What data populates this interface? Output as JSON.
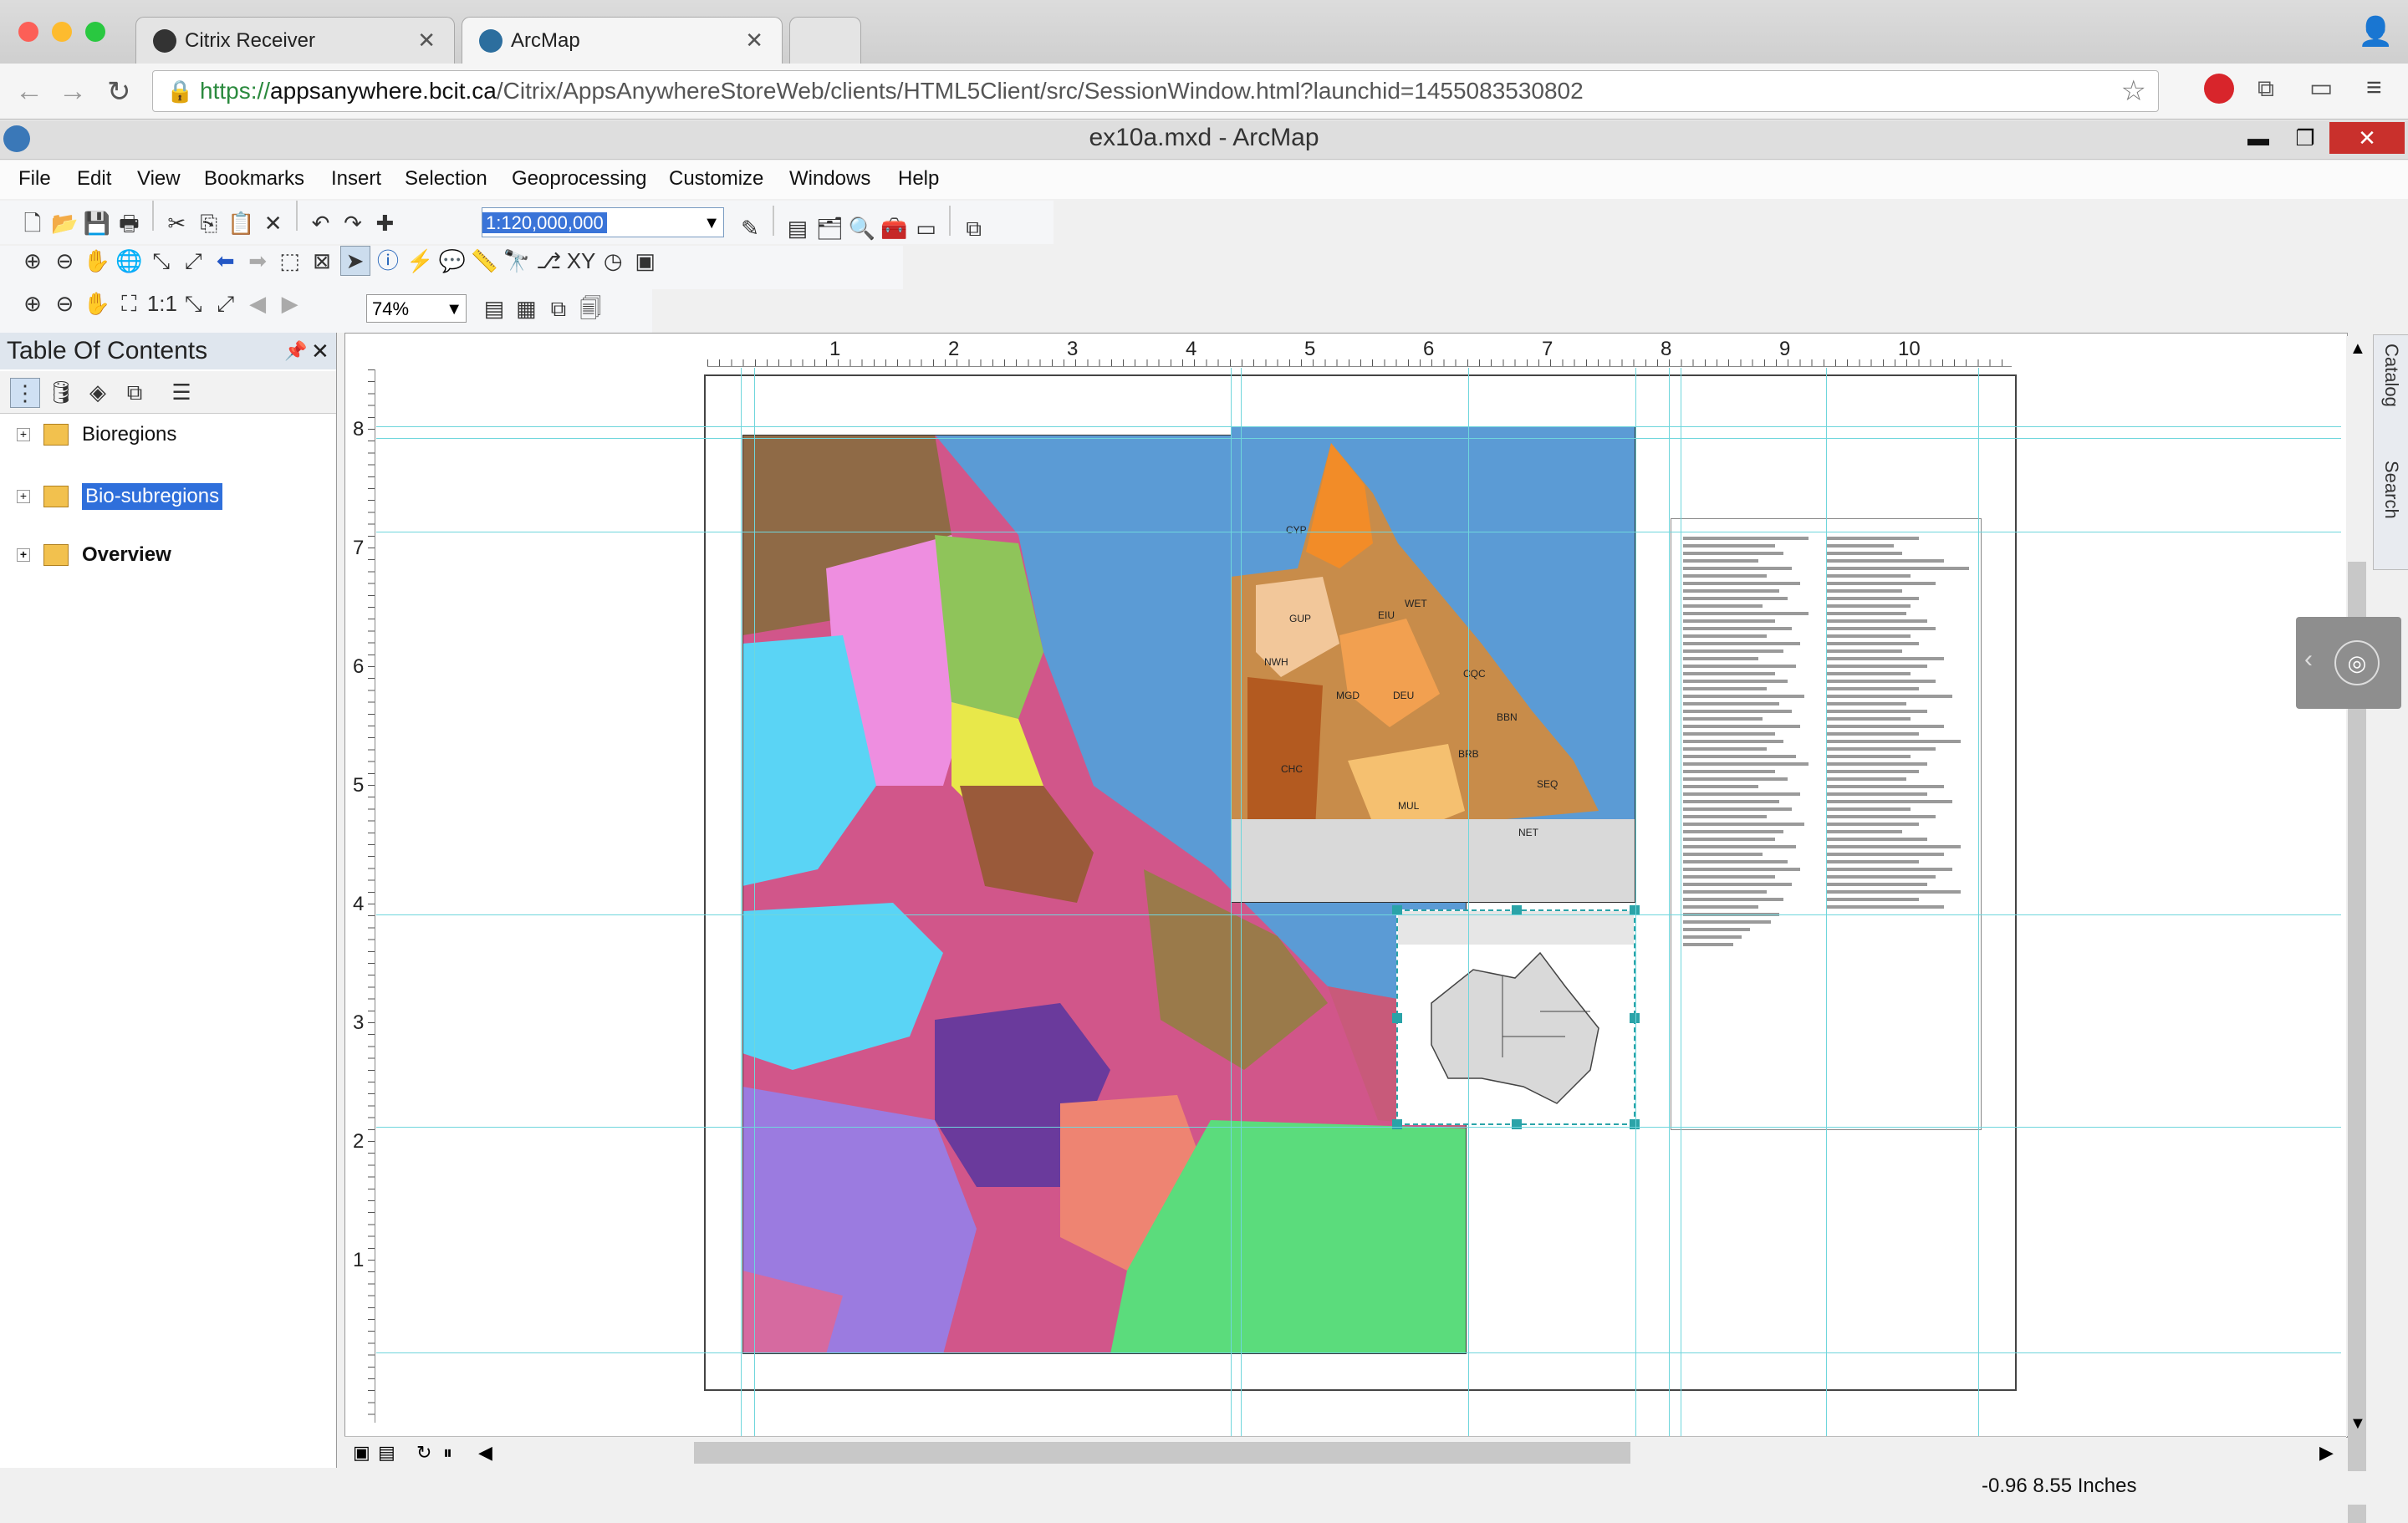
{
  "browser": {
    "tabs": [
      {
        "label": "Citrix Receiver"
      },
      {
        "label": "ArcMap"
      }
    ],
    "url": {
      "scheme": "https://",
      "host": "appsanywhere.bcit.ca",
      "path": "/Citrix/AppsAnywhereStoreWeb/clients/HTML5Client/src/SessionWindow.html?launchid=1455083530802"
    }
  },
  "app": {
    "title": "ex10a.mxd - ArcMap",
    "menus": [
      "File",
      "Edit",
      "View",
      "Bookmarks",
      "Insert",
      "Selection",
      "Geoprocessing",
      "Customize",
      "Windows",
      "Help"
    ],
    "scale": "1:120,000,000",
    "layout_zoom": "74%"
  },
  "toc": {
    "title": "Table Of Contents",
    "layers": [
      {
        "label": "Bioregions"
      },
      {
        "label": "Bio-subregions"
      },
      {
        "label": "Overview"
      }
    ]
  },
  "rulers": {
    "top": [
      "1",
      "2",
      "3",
      "4",
      "5",
      "6",
      "7",
      "8",
      "9",
      "10"
    ],
    "left": [
      "8",
      "7",
      "6",
      "5",
      "4",
      "3",
      "2",
      "1"
    ]
  },
  "dock": {
    "catalog": "Catalog",
    "search": "Search"
  },
  "map": {
    "inset_labels": [
      "CYP",
      "GUP",
      "EIU",
      "WET",
      "NWH",
      "MGD",
      "DEU",
      "CQC",
      "BBN",
      "CHC",
      "BRB",
      "SEQ",
      "MUL",
      "NET"
    ],
    "colors": {
      "ocean": "#5b9bd5",
      "pink": "#d1568a",
      "purple": "#6a3a9c",
      "lavender": "#9b7be0",
      "green": "#5bdc7c",
      "salmon": "#ee8472",
      "brown": "#8f6a46",
      "orange": "#f28c28"
    }
  },
  "status": {
    "coords": "-0.96  8.55 Inches"
  }
}
